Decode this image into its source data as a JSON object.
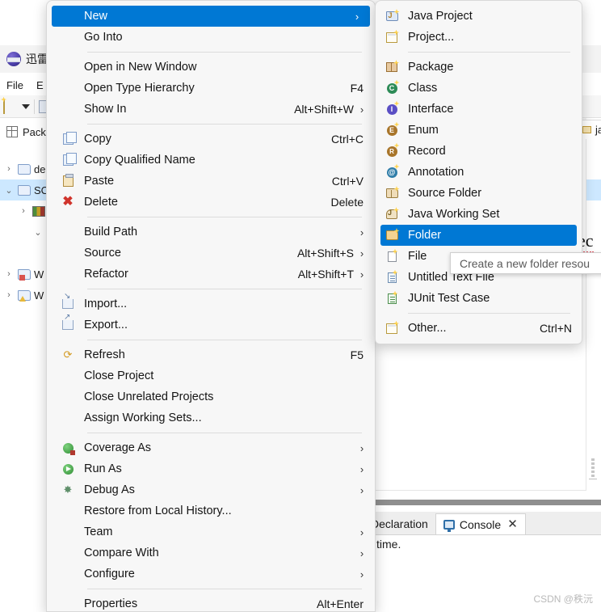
{
  "app": {
    "name": "迅雷",
    "icon": "thunder-icon"
  },
  "menubar": {
    "items": [
      {
        "label": "File"
      },
      {
        "label": "E"
      }
    ]
  },
  "explorer": {
    "view_tab": "Pack",
    "tree": [
      {
        "twisty": "›",
        "icon": "project-folder-icon",
        "label": "de"
      },
      {
        "twisty": "⌄",
        "icon": "project-folder-icon",
        "label": "SC",
        "selected": true
      },
      {
        "twisty": "›",
        "icon": "library-icon",
        "label": ""
      },
      {
        "twisty": "⌄",
        "icon": "package-icon",
        "label": ""
      },
      {
        "twisty": "›",
        "icon": "",
        "label": ""
      },
      {
        "twisty": "›",
        "icon": "project-folder-error-icon",
        "label": "W"
      },
      {
        "twisty": "›",
        "icon": "project-folder-warning-icon",
        "label": "W"
      }
    ]
  },
  "editor": {
    "tab_label": "jav",
    "code_fragment": "ec"
  },
  "bottom_panel": {
    "tabs": [
      {
        "label": "Declaration",
        "active": false,
        "icon": ""
      },
      {
        "label": "Console",
        "active": true,
        "icon": "console-icon",
        "closable": true,
        "close_glyph": "✕"
      }
    ],
    "output_line": "time.",
    "watermark": "CSDN @秩沅"
  },
  "context_menu": {
    "groups": [
      {
        "items": [
          {
            "label": "New",
            "accel": "",
            "arrow": "›",
            "icon": "",
            "highlight": true
          },
          {
            "label": "Go Into",
            "accel": "",
            "arrow": "",
            "icon": ""
          }
        ]
      },
      {
        "items": [
          {
            "label": "Open in New Window",
            "accel": "",
            "arrow": "",
            "icon": ""
          },
          {
            "label": "Open Type Hierarchy",
            "accel": "F4",
            "arrow": "",
            "icon": ""
          },
          {
            "label": "Show In",
            "accel": "Alt+Shift+W",
            "arrow": "›",
            "icon": ""
          }
        ]
      },
      {
        "items": [
          {
            "label": "Copy",
            "accel": "Ctrl+C",
            "arrow": "",
            "icon": "copy-icon"
          },
          {
            "label": "Copy Qualified Name",
            "accel": "",
            "arrow": "",
            "icon": "copy-qualified-name-icon"
          },
          {
            "label": "Paste",
            "accel": "Ctrl+V",
            "arrow": "",
            "icon": "paste-icon"
          },
          {
            "label": "Delete",
            "accel": "Delete",
            "arrow": "",
            "icon": "delete-icon"
          }
        ]
      },
      {
        "items": [
          {
            "label": "Build Path",
            "accel": "",
            "arrow": "›",
            "icon": ""
          },
          {
            "label": "Source",
            "accel": "Alt+Shift+S",
            "arrow": "›",
            "icon": ""
          },
          {
            "label": "Refactor",
            "accel": "Alt+Shift+T",
            "arrow": "›",
            "icon": ""
          }
        ]
      },
      {
        "items": [
          {
            "label": "Import...",
            "accel": "",
            "arrow": "",
            "icon": "import-icon"
          },
          {
            "label": "Export...",
            "accel": "",
            "arrow": "",
            "icon": "export-icon"
          }
        ]
      },
      {
        "items": [
          {
            "label": "Refresh",
            "accel": "F5",
            "arrow": "",
            "icon": "refresh-icon"
          },
          {
            "label": "Close Project",
            "accel": "",
            "arrow": "",
            "icon": ""
          },
          {
            "label": "Close Unrelated Projects",
            "accel": "",
            "arrow": "",
            "icon": ""
          },
          {
            "label": "Assign Working Sets...",
            "accel": "",
            "arrow": "",
            "icon": ""
          }
        ]
      },
      {
        "items": [
          {
            "label": "Coverage As",
            "accel": "",
            "arrow": "›",
            "icon": "coverage-icon"
          },
          {
            "label": "Run As",
            "accel": "",
            "arrow": "›",
            "icon": "run-icon"
          },
          {
            "label": "Debug As",
            "accel": "",
            "arrow": "›",
            "icon": "debug-icon"
          },
          {
            "label": "Restore from Local History...",
            "accel": "",
            "arrow": "",
            "icon": ""
          },
          {
            "label": "Team",
            "accel": "",
            "arrow": "›",
            "icon": ""
          },
          {
            "label": "Compare With",
            "accel": "",
            "arrow": "›",
            "icon": ""
          },
          {
            "label": "Configure",
            "accel": "",
            "arrow": "›",
            "icon": ""
          }
        ]
      },
      {
        "items": [
          {
            "label": "Properties",
            "accel": "Alt+Enter",
            "arrow": "",
            "icon": ""
          }
        ]
      }
    ]
  },
  "new_submenu": {
    "groups": [
      {
        "items": [
          {
            "label": "Java Project",
            "accel": "",
            "icon": "java-project-icon"
          },
          {
            "label": "Project...",
            "accel": "",
            "icon": "project-icon"
          }
        ]
      },
      {
        "items": [
          {
            "label": "Package",
            "accel": "",
            "icon": "package-icon"
          },
          {
            "label": "Class",
            "accel": "",
            "icon": "class-icon"
          },
          {
            "label": "Interface",
            "accel": "",
            "icon": "interface-icon"
          },
          {
            "label": "Enum",
            "accel": "",
            "icon": "enum-icon"
          },
          {
            "label": "Record",
            "accel": "",
            "icon": "record-icon"
          },
          {
            "label": "Annotation",
            "accel": "",
            "icon": "annotation-icon"
          },
          {
            "label": "Source Folder",
            "accel": "",
            "icon": "source-folder-icon"
          },
          {
            "label": "Java Working Set",
            "accel": "",
            "icon": "java-working-set-icon"
          },
          {
            "label": "Folder",
            "accel": "",
            "icon": "folder-icon",
            "highlight": true
          },
          {
            "label": "File",
            "accel": "",
            "icon": "file-icon"
          },
          {
            "label": "Untitled Text File",
            "accel": "",
            "icon": "text-file-icon"
          },
          {
            "label": "JUnit Test Case",
            "accel": "",
            "icon": "junit-test-case-icon"
          }
        ]
      },
      {
        "items": [
          {
            "label": "Other...",
            "accel": "Ctrl+N",
            "icon": "other-icon"
          }
        ]
      }
    ]
  },
  "tooltip": {
    "text": "Create a new folder resou"
  },
  "colors": {
    "highlight": "#0078d4",
    "menu_bg": "#f7f7f7",
    "menu_text": "#141414",
    "selection_tree": "#cde8ff"
  }
}
